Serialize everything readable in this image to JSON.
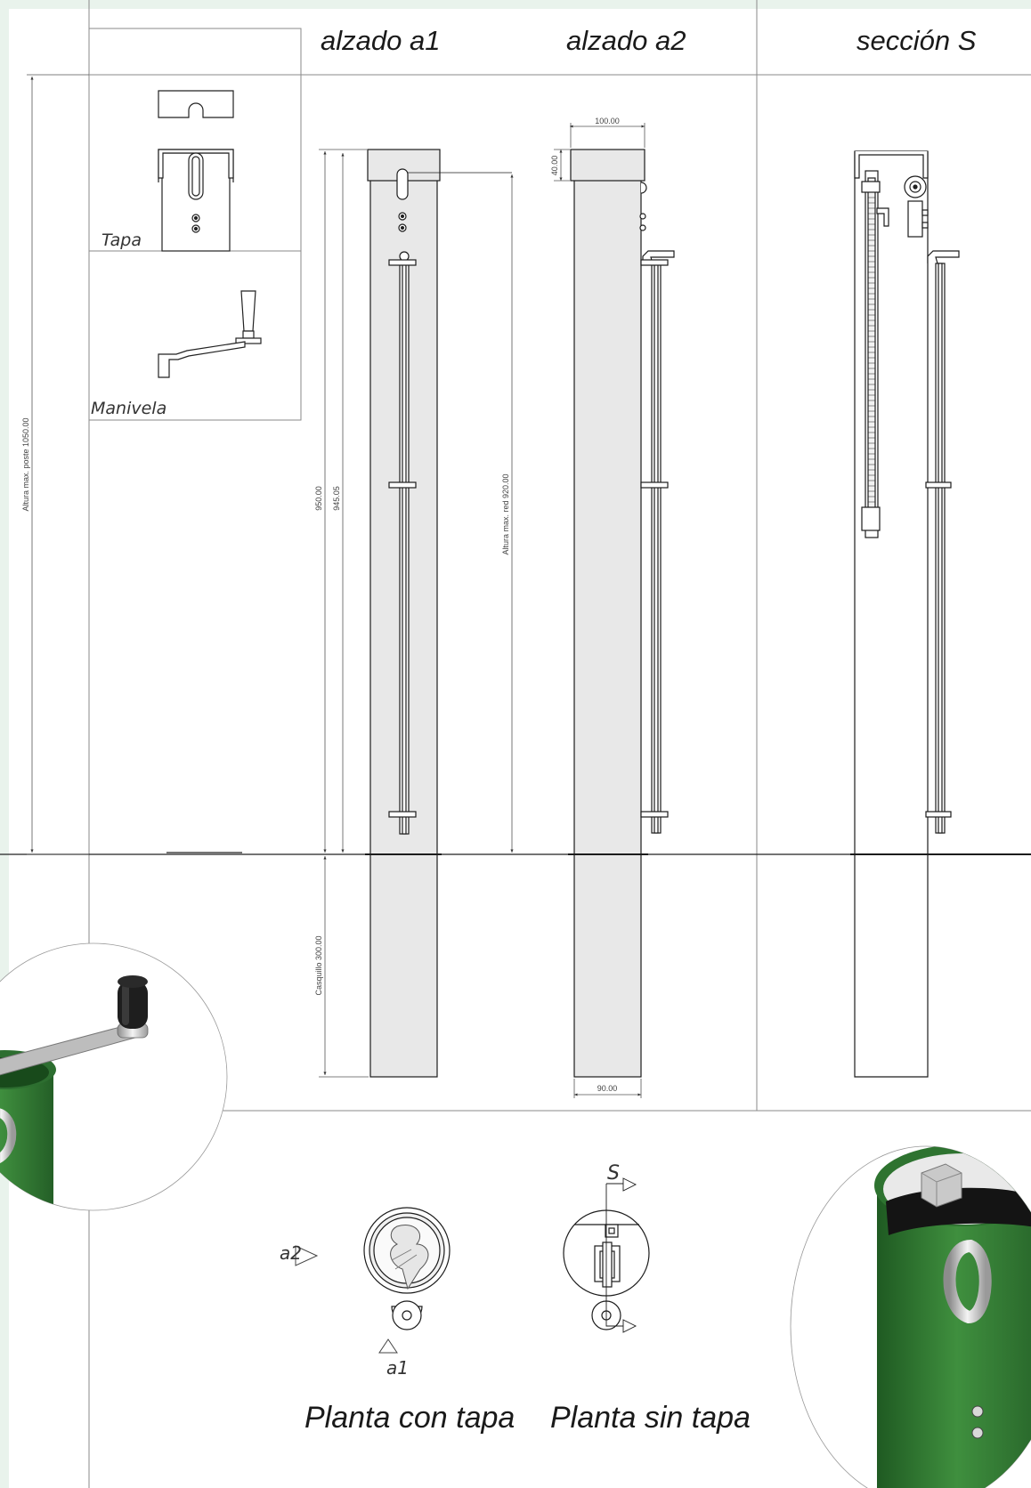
{
  "titles": {
    "elevation_a1": "alzado a1",
    "elevation_a2": "alzado a2",
    "section_s": "sección S",
    "plan_with_cap": "Planta con tapa",
    "plan_without_cap": "Planta sin tapa"
  },
  "detail_labels": {
    "cap": "Tapa",
    "crank": "Manivela"
  },
  "dimensions": {
    "max_post_height": "Altura max. poste 1050.00",
    "height_950": "950.00",
    "height_945": "945.05",
    "max_net_height": "Altura max. red 920.00",
    "cap_width": "100.00",
    "cap_height": "40.00",
    "sleeve_depth": "Casquillo 300.00",
    "post_width": "90.00"
  },
  "view_markers": {
    "a1": "a1",
    "a2": "a2",
    "s": "S"
  },
  "colors": {
    "post_fill": "#e8e8e8",
    "line": "#1c1c1c",
    "background_accent": "#e7f2ea",
    "post_green": "#3c8a3c"
  }
}
